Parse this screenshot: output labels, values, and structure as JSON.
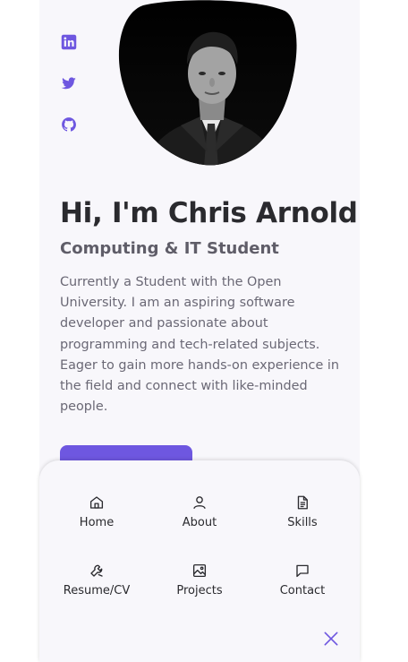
{
  "colors": {
    "accent": "#6e57e0",
    "background": "#f8f7fb",
    "heading": "#2a2a2e",
    "text": "#6a6875"
  },
  "social_links": [
    {
      "icon": "linkedin-icon"
    },
    {
      "icon": "twitter-icon"
    },
    {
      "icon": "github-icon"
    }
  ],
  "hero": {
    "title": "Hi, I'm Chris Arnold",
    "subtitle": "Computing & IT Student",
    "description": "Currently a Student with the Open University. I am an aspiring software developer and passionate about programming and tech-related subjects. Eager to gain more hands-on experience in the field and connect with like-minded people."
  },
  "menu": {
    "items": [
      {
        "label": "Home",
        "icon": "home-icon"
      },
      {
        "label": "About",
        "icon": "user-icon"
      },
      {
        "label": "Skills",
        "icon": "file-icon"
      },
      {
        "label": "Resume/CV",
        "icon": "wrench-icon"
      },
      {
        "label": "Projects",
        "icon": "image-icon"
      },
      {
        "label": "Contact",
        "icon": "message-icon"
      }
    ],
    "close_icon": "close-icon"
  }
}
